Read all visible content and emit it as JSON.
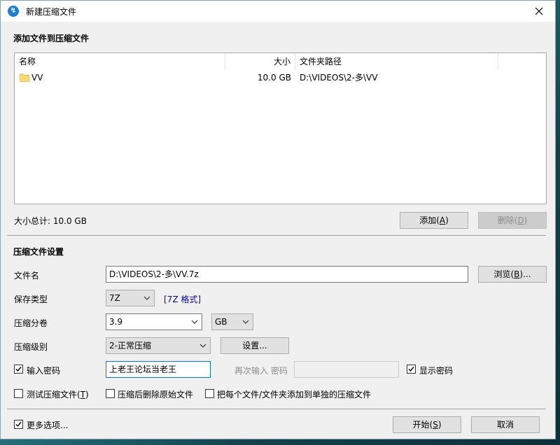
{
  "window": {
    "title": "新建压缩文件"
  },
  "section_add": {
    "title": "添加文件到压缩文件"
  },
  "file_list": {
    "columns": [
      "名称",
      "大小",
      "文件夹路径"
    ],
    "rows": [
      {
        "name": "VV",
        "size": "10.0 GB",
        "path": "D:\\VIDEOS\\2-多\\VV"
      }
    ]
  },
  "total_size": "大小总计: 10.0 GB",
  "add_button": {
    "label": "添加(",
    "key": "A",
    "tail": ")"
  },
  "delete_button": {
    "label": "删除(",
    "key": "D",
    "tail": ")"
  },
  "section_settings": {
    "title": "压缩文件设置"
  },
  "filename": {
    "label": "文件名",
    "value": "D:\\VIDEOS\\2-多\\VV.7z"
  },
  "browse_button": {
    "label": "浏览(",
    "key": "B",
    "tail": ")..."
  },
  "save_type": {
    "label": "保存类型",
    "value": "7Z",
    "format_link": "[7Z 格式]"
  },
  "split": {
    "label": "压缩分卷",
    "value": "3.9",
    "unit": "GB"
  },
  "level": {
    "label": "压缩级别",
    "value": "2-正常压缩"
  },
  "settings_button": {
    "label": "设置..."
  },
  "password": {
    "label": "输入密码",
    "checked": true,
    "value": "上老王论坛当老王"
  },
  "confirm_password": {
    "label": "再次输入 密码",
    "value": ""
  },
  "show_password": {
    "label": "显示密码",
    "checked": true
  },
  "test_archive": {
    "label_a": "测试压缩文件(",
    "key": "T",
    "tail": ")",
    "checked": false
  },
  "delete_after": {
    "label": "压缩后删除原始文件",
    "checked": false
  },
  "separate": {
    "label": "把每个文件/文件夹添加到单独的压缩文件",
    "checked": false
  },
  "more_options": {
    "label": "更多选项...",
    "checked": true
  },
  "start_button": {
    "label": "开始(",
    "key": "S",
    "tail": ")"
  },
  "cancel_button": {
    "label": "取消"
  },
  "colors": {
    "accent": "#0078d7",
    "link": "#0000c8",
    "window_bg": "#f0f0f0"
  }
}
